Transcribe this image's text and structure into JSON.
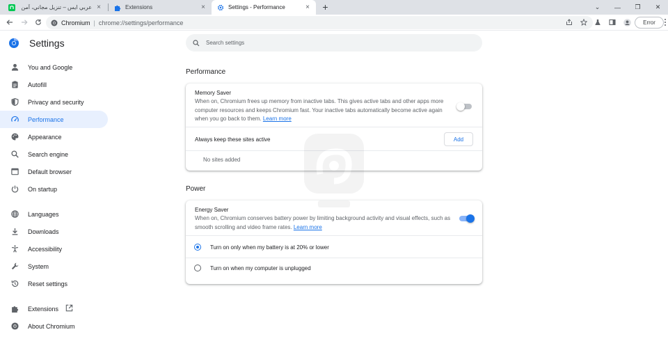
{
  "tabs": [
    {
      "label": "عربي ايس – تنزيل مجاني، آمن ويسر",
      "close": "×"
    },
    {
      "label": "Extensions",
      "close": "×"
    },
    {
      "label": "Settings - Performance",
      "close": "×",
      "active": true
    }
  ],
  "new_tab": "+",
  "window_controls": {
    "minimize": "—",
    "restore": "❐",
    "close": "✕",
    "dropdown": "⌄"
  },
  "omnibox": {
    "host": "Chromium",
    "separator": "|",
    "url": "chrome://settings/performance"
  },
  "toolbar": {
    "error_label": "Error"
  },
  "settings": {
    "title": "Settings",
    "search_placeholder": "Search settings"
  },
  "sidebar": {
    "items": [
      {
        "label": "You and Google",
        "icon": "person-icon"
      },
      {
        "label": "Autofill",
        "icon": "clipboard-icon"
      },
      {
        "label": "Privacy and security",
        "icon": "shield-icon"
      },
      {
        "label": "Performance",
        "icon": "speedometer-icon",
        "active": true
      },
      {
        "label": "Appearance",
        "icon": "palette-icon"
      },
      {
        "label": "Search engine",
        "icon": "search-icon"
      },
      {
        "label": "Default browser",
        "icon": "browser-icon"
      },
      {
        "label": "On startup",
        "icon": "power-icon"
      },
      {
        "label": "Languages",
        "icon": "globe-icon"
      },
      {
        "label": "Downloads",
        "icon": "download-icon"
      },
      {
        "label": "Accessibility",
        "icon": "accessibility-icon"
      },
      {
        "label": "System",
        "icon": "wrench-icon"
      },
      {
        "label": "Reset settings",
        "icon": "history-icon"
      },
      {
        "label": "Extensions",
        "icon": "puzzle-icon"
      },
      {
        "label": "About Chromium",
        "icon": "chromium-icon"
      }
    ]
  },
  "performance": {
    "section_title": "Performance",
    "memory_saver": {
      "title": "Memory Saver",
      "description": "When on, Chromium frees up memory from inactive tabs. This gives active tabs and other apps more computer resources and keeps Chromium fast. Your inactive tabs automatically become active again when you go back to them.",
      "learn_more": "Learn more",
      "enabled": false
    },
    "always_active": {
      "label": "Always keep these sites active",
      "add_button": "Add",
      "empty_text": "No sites added"
    }
  },
  "power": {
    "section_title": "Power",
    "energy_saver": {
      "title": "Energy Saver",
      "description": "When on, Chromium conserves battery power by limiting background activity and visual effects, such as smooth scrolling and video frame rates.",
      "learn_more": "Learn more",
      "enabled": true
    },
    "options": [
      {
        "label": "Turn on only when my battery is at 20% or lower",
        "checked": true
      },
      {
        "label": "Turn on when my computer is unplugged",
        "checked": false
      }
    ]
  },
  "colors": {
    "accent": "#1a73e8",
    "active_bg": "#e8f0fe",
    "tabstrip_bg": "#dee1e6"
  }
}
